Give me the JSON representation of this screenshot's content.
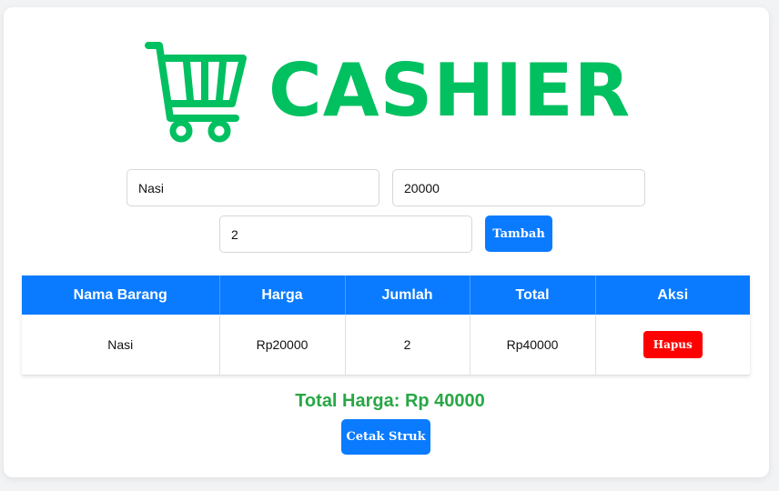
{
  "app": {
    "logo_text": "CASHIER",
    "brand_color": "#00c060",
    "icon": "shopping-cart-icon"
  },
  "form": {
    "name_value": "Nasi",
    "price_value": "20000",
    "qty_value": "2",
    "add_label": "Tambah"
  },
  "table": {
    "headers": [
      "Nama Barang",
      "Harga",
      "Jumlah",
      "Total",
      "Aksi"
    ],
    "rows": [
      {
        "name": "Nasi",
        "price": "Rp20000",
        "qty": "2",
        "total": "Rp40000",
        "action": "Hapus"
      }
    ]
  },
  "summary": {
    "total_label": "Total Harga: Rp 40000",
    "print_label": "Cetak Struk"
  },
  "colors": {
    "primary": "#0a7bff",
    "danger": "#ff0000",
    "success": "#28a745"
  }
}
